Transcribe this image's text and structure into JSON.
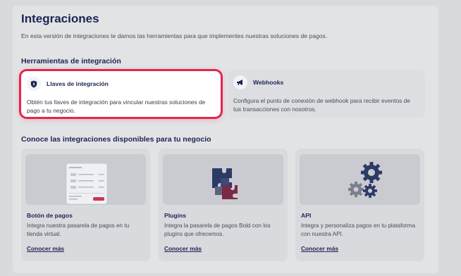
{
  "page": {
    "title": "Integraciones",
    "subtitle": "En esta versión de integraciones te damos las herramientas para que implementes nuestras soluciones de pagos."
  },
  "tools": {
    "heading": "Herramientas de integración",
    "items": [
      {
        "title": "Llaves de integración",
        "description": "Obtén tus llaves de integración para vincular nuestras soluciones de pago a tu negocio.",
        "icon": "shield-icon",
        "highlighted": true
      },
      {
        "title": "Webhooks",
        "description": "Configura el punto de conexión de webhook para recibir eventos de tus transacciones con nosotros.",
        "icon": "megaphone-icon",
        "highlighted": false
      }
    ]
  },
  "integrations": {
    "heading": "Conoce las integraciones disponibles para tu negocio",
    "items": [
      {
        "title": "Botón de pagos",
        "description": "Integra nuestra pasarela de pagos en tu tienda virtual.",
        "link": "Conocer más",
        "illustration": "payment-button-illustration"
      },
      {
        "title": "Plugins",
        "description": "Integra la pasarela de pagos Bold con los plugins que ofrecemos.",
        "link": "Conocer más",
        "illustration": "puzzle-illustration"
      },
      {
        "title": "API",
        "description": "Integra y personaliza pagos en tu plataforma con nuestra API.",
        "link": "Conocer más",
        "illustration": "gears-illustration"
      }
    ]
  },
  "colors": {
    "highlight": "#e8244b",
    "brand_navy": "#1c2453"
  }
}
